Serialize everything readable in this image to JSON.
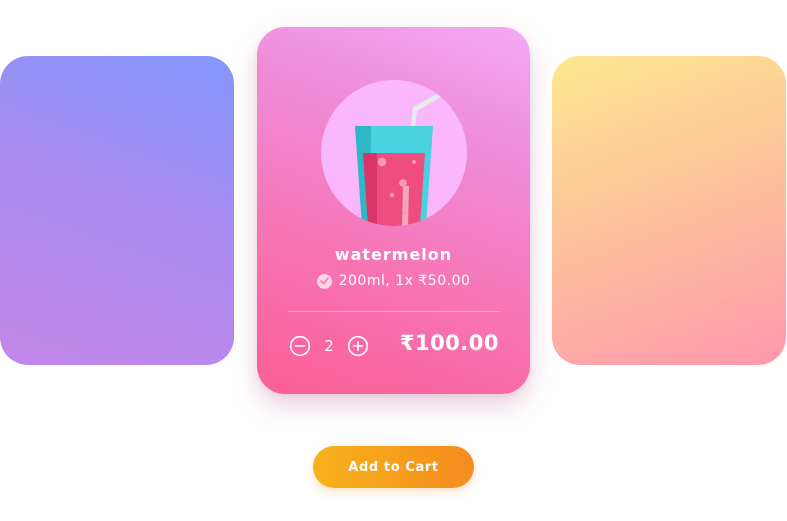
{
  "product": {
    "name": "watermelon",
    "variant": "200ml, 1x ₹50.00",
    "quantity": "2",
    "total": "₹100.00"
  },
  "actions": {
    "add_to_cart_label": "Add to Cart"
  },
  "icons": {
    "drink": "juice-glass-icon",
    "variant_check": "check-circle-icon",
    "decrease": "minus-circle-icon",
    "increase": "plus-circle-icon"
  },
  "colors": {
    "left_card_gradient": [
      "#8497fb",
      "#c487ea"
    ],
    "main_card_gradient": [
      "#f4a9f4",
      "#fb5e93"
    ],
    "right_card_gradient": [
      "#fde88f",
      "#ff97ae"
    ],
    "button_gradient": [
      "#f7b21c",
      "#f68b1f"
    ]
  }
}
